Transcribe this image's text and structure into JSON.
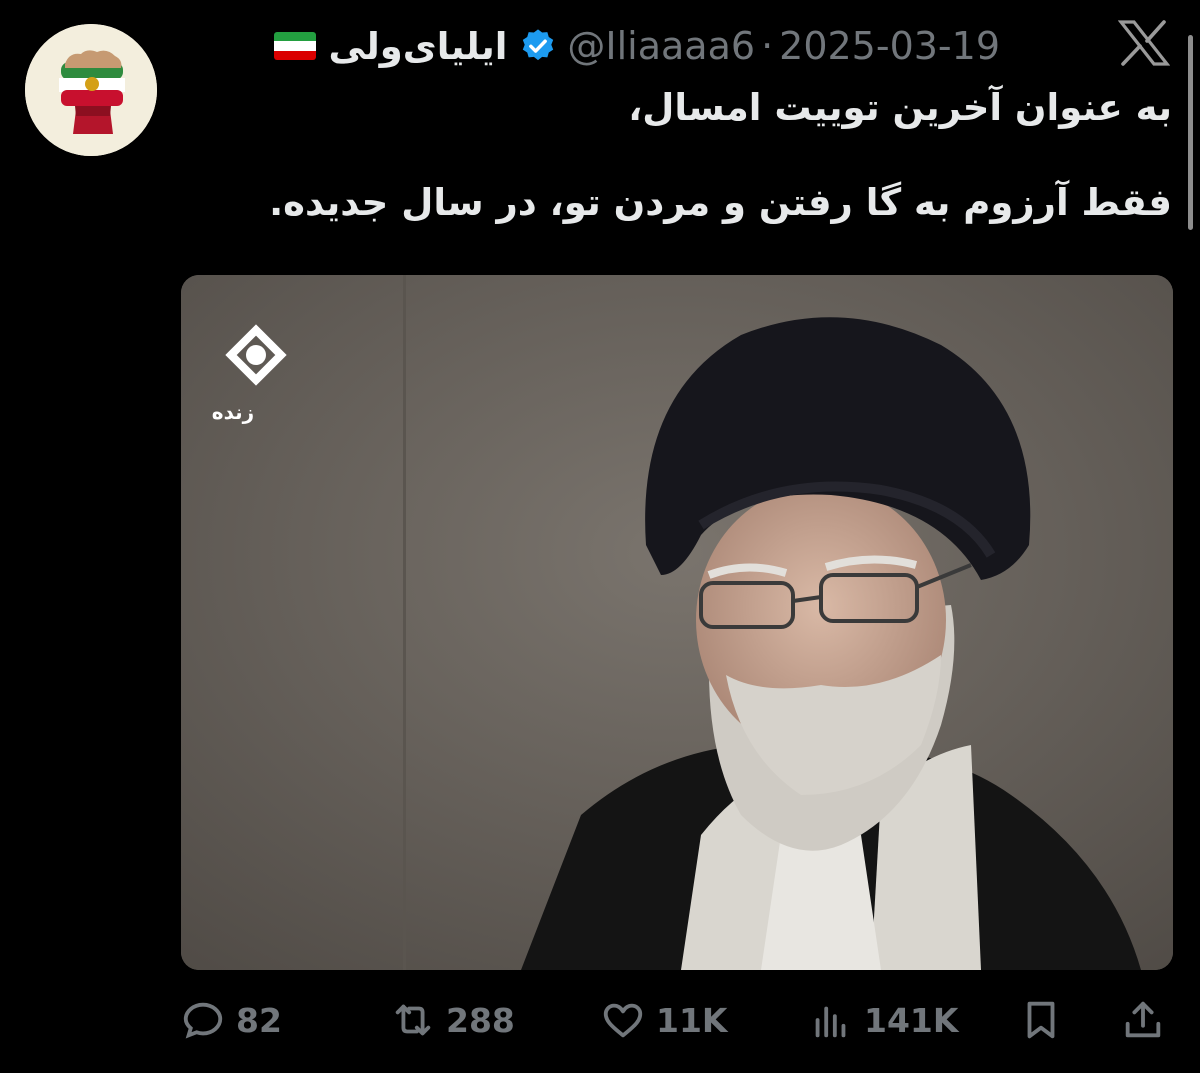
{
  "author": {
    "display_name": "ایلیای‌ولی",
    "handle": "@Iliaaaa6",
    "date": "2025-03-19",
    "separator": "·",
    "verified": true,
    "flag_colors": [
      "#239f40",
      "#ffffff",
      "#da0000"
    ],
    "avatar_icon": "fist-with-lion-and-sun-flag-icon"
  },
  "brand_icon": "x-logo-icon",
  "tweet": {
    "lines": [
      "به عنوان آخرین توییت امسال،",
      "فقط آرزوم به گا رفتن و مردن تو، در سال جدیده."
    ]
  },
  "media": {
    "channel_icon": "irib-channel-logo-icon",
    "live_label": "زنده"
  },
  "actions": {
    "replies": "82",
    "retweets": "288",
    "likes": "11K",
    "views": "141K"
  },
  "colors": {
    "background": "#000000",
    "text_primary": "#e7e9ea",
    "text_secondary": "#71767b",
    "verified_badge": "#1d9bf0"
  }
}
